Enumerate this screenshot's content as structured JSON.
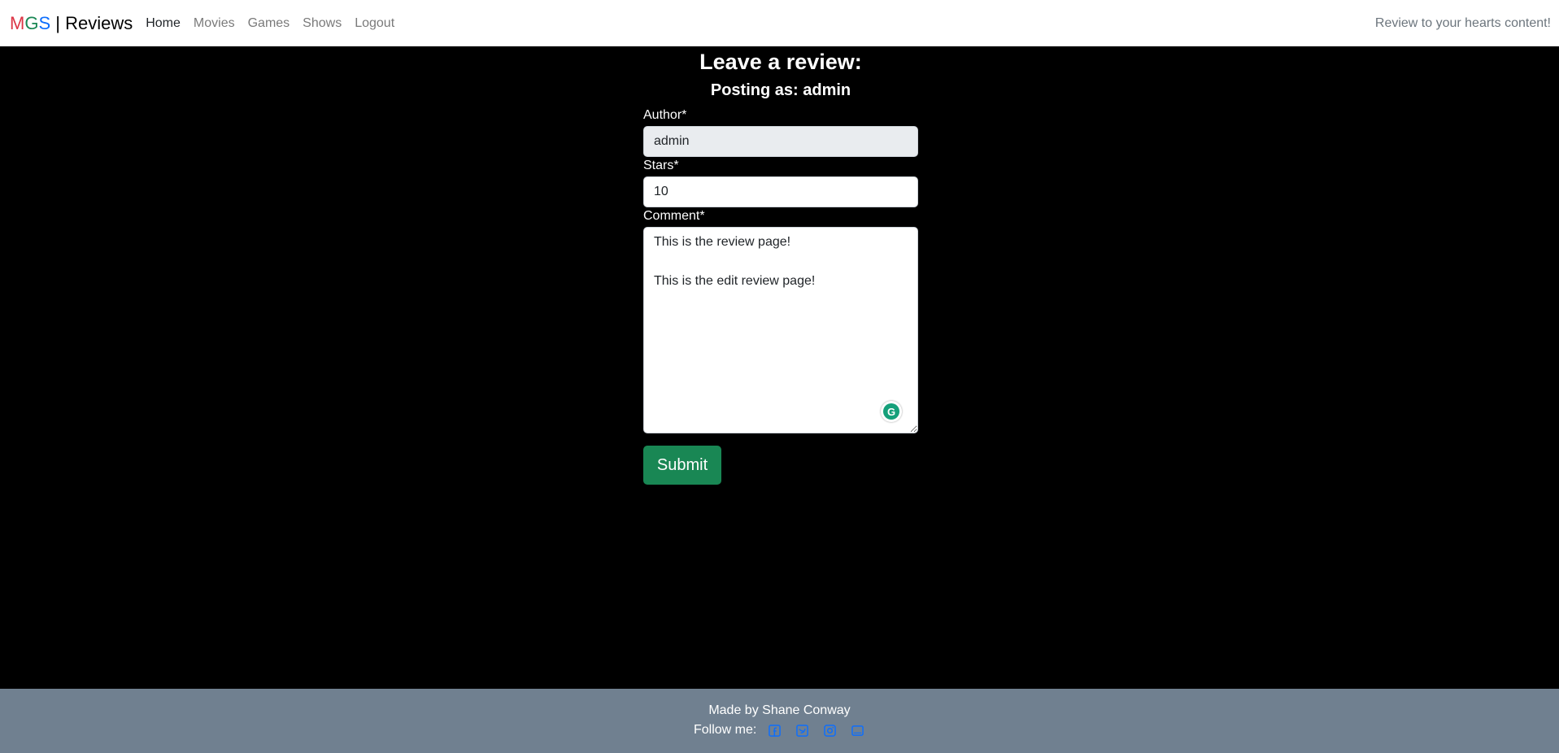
{
  "navbar": {
    "brand_m": "M",
    "brand_g": "G",
    "brand_s": "S",
    "brand_rest": " | Reviews",
    "links": [
      "Home",
      "Movies",
      "Games",
      "Shows",
      "Logout"
    ],
    "tagline": "Review to your hearts content!"
  },
  "form": {
    "heading": "Leave a review:",
    "subheading": "Posting as: admin",
    "author_label": "Author*",
    "author_value": "admin",
    "stars_label": "Stars*",
    "stars_value": "10",
    "comment_label": "Comment*",
    "comment_value": "This is the review page!\n\nThis is the edit review page!",
    "submit_label": "Submit"
  },
  "footer": {
    "made_by": "Made by Shane Conway",
    "follow_label": "Follow me:",
    "social_icons": [
      "facebook-icon",
      "twitter-icon",
      "instagram-icon",
      "youtube-icon"
    ],
    "social_color": "#0d6efd"
  },
  "colors": {
    "page_background": "#000000",
    "footer_background": "#708090",
    "submit_button": "#198754"
  }
}
